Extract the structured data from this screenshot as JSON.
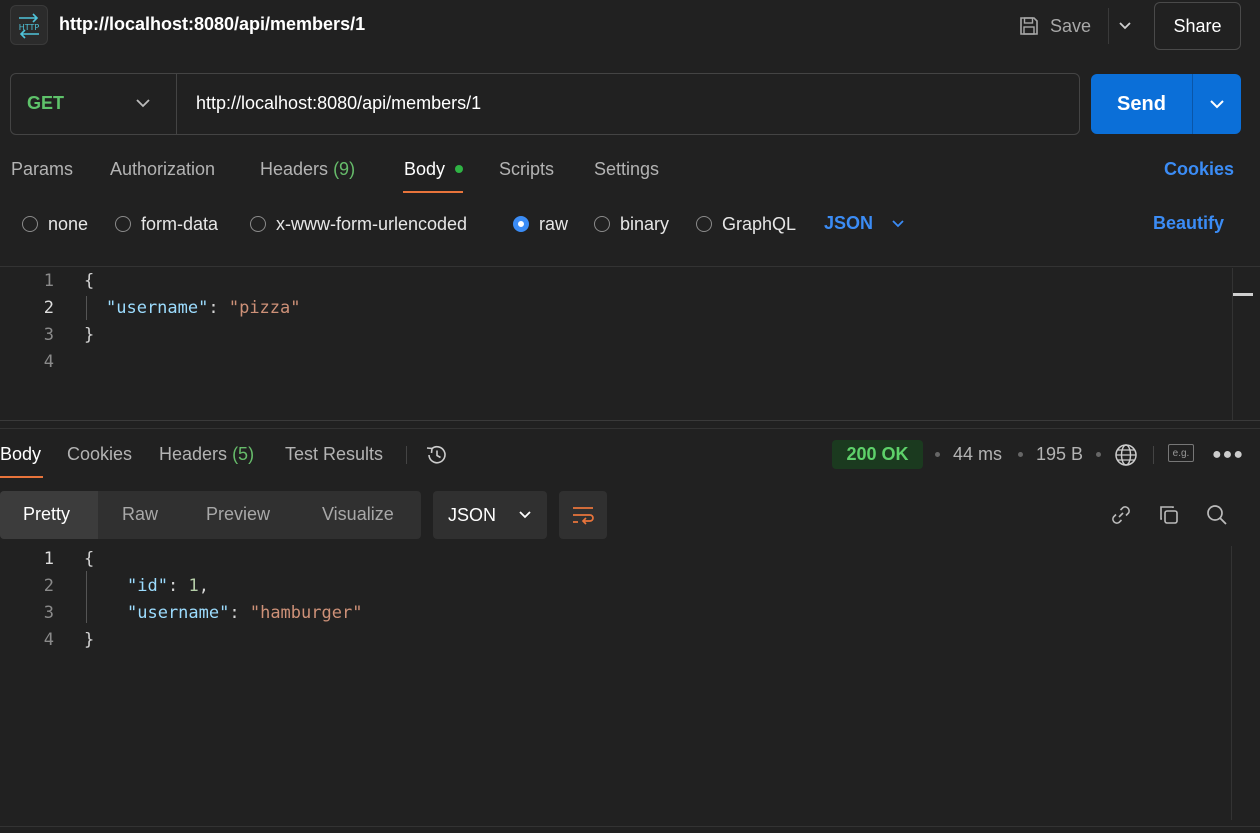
{
  "header": {
    "icon_label": "HTTP",
    "title": "http://localhost:8080/api/members/1",
    "save_label": "Save",
    "share_label": "Share"
  },
  "request": {
    "method": "GET",
    "url": "http://localhost:8080/api/members/1",
    "send_label": "Send",
    "tabs": {
      "params": "Params",
      "authorization": "Authorization",
      "headers": "Headers",
      "headers_count": "(9)",
      "body": "Body",
      "scripts": "Scripts",
      "settings": "Settings"
    },
    "cookies_label": "Cookies",
    "body_types": [
      "none",
      "form-data",
      "x-www-form-urlencoded",
      "raw",
      "binary",
      "GraphQL"
    ],
    "selected_body_type": "raw",
    "format": "JSON",
    "beautify_label": "Beautify",
    "line_numbers": [
      "1",
      "2",
      "3",
      "4"
    ],
    "code": {
      "open": "{",
      "key": "\"username\"",
      "colon": ": ",
      "value": "\"pizza\"",
      "close": "}"
    }
  },
  "response": {
    "tabs": {
      "body": "Body",
      "cookies": "Cookies",
      "headers": "Headers",
      "headers_count": "(5)",
      "test_results": "Test Results"
    },
    "status": "200 OK",
    "time": "44 ms",
    "size": "195 B",
    "eg_label": "e.g.",
    "views": [
      "Pretty",
      "Raw",
      "Preview",
      "Visualize"
    ],
    "format": "JSON",
    "line_numbers": [
      "1",
      "2",
      "3",
      "4"
    ],
    "code": {
      "open": "{",
      "id_key": "\"id\"",
      "id_value": "1",
      "username_key": "\"username\"",
      "username_value": "\"hamburger\"",
      "close": "}"
    }
  },
  "colors": {
    "accent": "#e8743b",
    "send": "#0b6fd8",
    "link": "#3b8cf5",
    "status_ok": "#5ed16a"
  }
}
